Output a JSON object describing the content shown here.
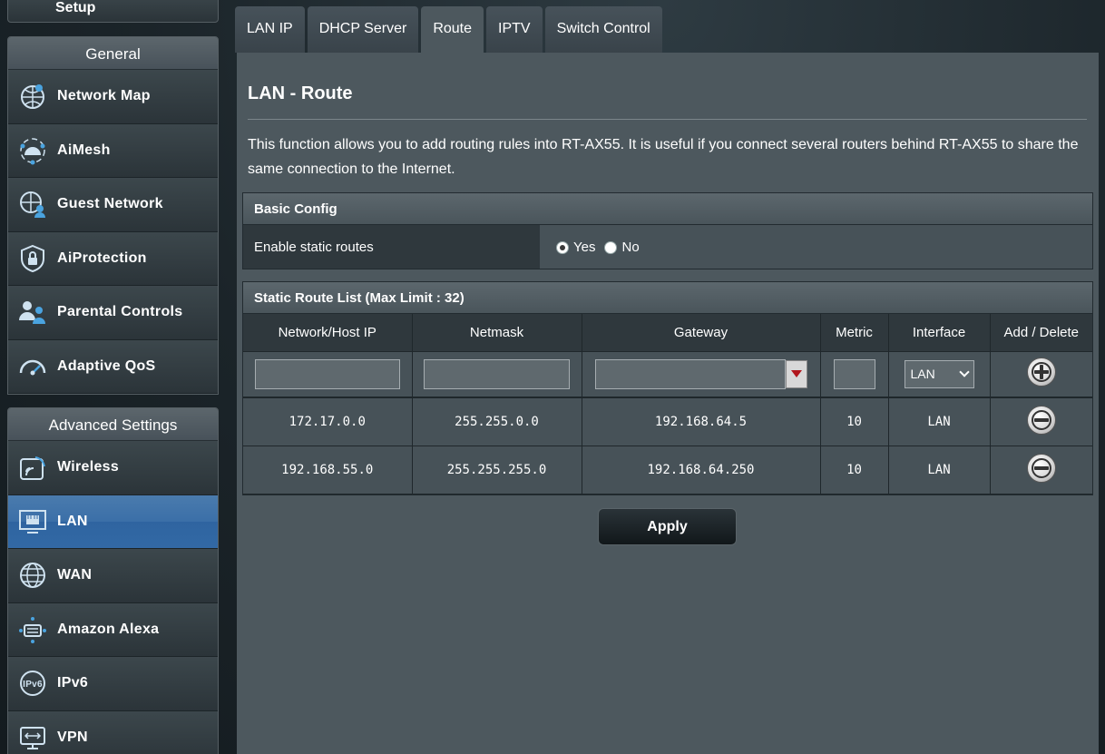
{
  "sidebar": {
    "setup_label": "Setup",
    "general": {
      "heading": "General",
      "items": [
        {
          "label": "Network Map",
          "icon": "network-map-icon"
        },
        {
          "label": "AiMesh",
          "icon": "aimesh-icon"
        },
        {
          "label": "Guest Network",
          "icon": "guest-network-icon"
        },
        {
          "label": "AiProtection",
          "icon": "aiprotection-icon"
        },
        {
          "label": "Parental Controls",
          "icon": "parental-controls-icon"
        },
        {
          "label": "Adaptive QoS",
          "icon": "adaptive-qos-icon"
        }
      ]
    },
    "advanced": {
      "heading": "Advanced Settings",
      "items": [
        {
          "label": "Wireless",
          "icon": "wireless-icon"
        },
        {
          "label": "LAN",
          "icon": "lan-icon",
          "active": true
        },
        {
          "label": "WAN",
          "icon": "wan-icon"
        },
        {
          "label": "Amazon Alexa",
          "icon": "alexa-icon"
        },
        {
          "label": "IPv6",
          "icon": "ipv6-icon"
        },
        {
          "label": "VPN",
          "icon": "vpn-icon"
        }
      ]
    }
  },
  "tabs": [
    {
      "label": "LAN IP"
    },
    {
      "label": "DHCP Server"
    },
    {
      "label": "Route",
      "active": true
    },
    {
      "label": "IPTV"
    },
    {
      "label": "Switch Control"
    }
  ],
  "page": {
    "title": "LAN - Route",
    "description": "This function allows you to add routing rules into RT-AX55. It is useful if you connect several routers behind RT-AX55 to share the same connection to the Internet."
  },
  "basic_config": {
    "heading": "Basic Config",
    "enable_label": "Enable static routes",
    "options": [
      {
        "label": "Yes",
        "checked": true
      },
      {
        "label": "No",
        "checked": false
      }
    ]
  },
  "route_list": {
    "heading": "Static Route List (Max Limit : 32)",
    "columns": [
      "Network/Host IP",
      "Netmask",
      "Gateway",
      "Metric",
      "Interface",
      "Add / Delete"
    ],
    "new_entry": {
      "network": "",
      "netmask": "",
      "gateway": "",
      "metric": "",
      "interface": "LAN"
    },
    "rows": [
      {
        "network": "172.17.0.0",
        "netmask": "255.255.0.0",
        "gateway": "192.168.64.5",
        "metric": "10",
        "interface": "LAN"
      },
      {
        "network": "192.168.55.0",
        "netmask": "255.255.255.0",
        "gateway": "192.168.64.250",
        "metric": "10",
        "interface": "LAN"
      }
    ]
  },
  "apply_label": "Apply",
  "colors": {
    "active_menu": "#3b6fa8",
    "panel_bg": "#4d585e",
    "gateway_dropdown_arrow": "#b1161c"
  }
}
